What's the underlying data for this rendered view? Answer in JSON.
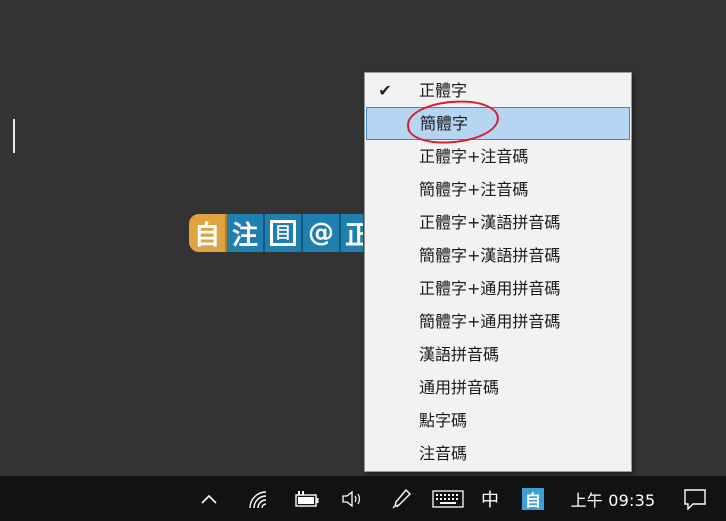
{
  "ime_toolbar": {
    "mode": "自",
    "zhuyin": "注",
    "fullwidth": "目",
    "symbol": "@",
    "script_partial": "正"
  },
  "menu": {
    "items": [
      {
        "label": "正體字",
        "checked": true
      },
      {
        "label": "簡體字",
        "highlighted": true
      },
      {
        "label": "正體字+注音碼"
      },
      {
        "label": "簡體字+注音碼"
      },
      {
        "label": "正體字+漢語拼音碼"
      },
      {
        "label": "簡體字+漢語拼音碼"
      },
      {
        "label": "正體字+通用拼音碼"
      },
      {
        "label": "簡體字+通用拼音碼"
      },
      {
        "label": "漢語拼音碼"
      },
      {
        "label": "通用拼音碼"
      },
      {
        "label": "點字碼"
      },
      {
        "label": "注音碼"
      }
    ],
    "check_glyph": "✔"
  },
  "taskbar": {
    "language": "中",
    "ime_tray": "自",
    "clock": "上午 09:35"
  },
  "colors": {
    "desktop": "#333333",
    "menu_bg": "#f2f2f2",
    "highlight_bg": "#b5d5f3",
    "highlight_border": "#3c87cc",
    "annotation": "#d41f2a",
    "toolbar_blue": "#1e7fb0",
    "toolbar_orange": "#e0a341",
    "taskbar": "#121212"
  }
}
